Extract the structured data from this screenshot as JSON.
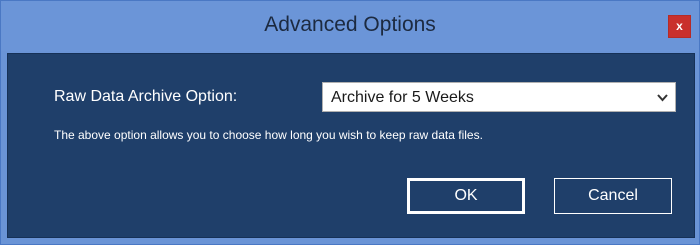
{
  "window": {
    "title": "Advanced Options",
    "close_label": "x"
  },
  "form": {
    "raw_data_label": "Raw Data Archive Option:",
    "archive_select_value": "Archive for 5 Weeks",
    "help_text": "The above option allows you to choose how long you wish to keep raw data files."
  },
  "buttons": {
    "ok_label": "OK",
    "cancel_label": "Cancel"
  },
  "colors": {
    "titlebar": "#6b95d8",
    "content_background": "#1f3f6a",
    "close_button": "#c9302c",
    "text": "#ffffff"
  },
  "icons": {
    "dropdown": "chevron-down-icon",
    "close": "close-icon"
  }
}
